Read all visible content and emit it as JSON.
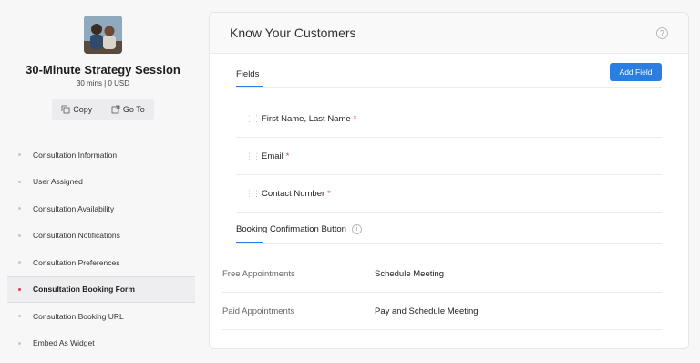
{
  "session": {
    "title": "30-Minute Strategy Session",
    "meta": "30 mins | 0 USD",
    "copy_label": "Copy",
    "goto_label": "Go To"
  },
  "nav": [
    {
      "label": "Consultation Information",
      "active": false
    },
    {
      "label": "User Assigned",
      "active": false
    },
    {
      "label": "Consultation Availability",
      "active": false
    },
    {
      "label": "Consultation Notifications",
      "active": false
    },
    {
      "label": "Consultation Preferences",
      "active": false
    },
    {
      "label": "Consultation Booking Form",
      "active": true
    },
    {
      "label": "Consultation Booking URL",
      "active": false
    },
    {
      "label": "Embed As Widget",
      "active": false
    }
  ],
  "card": {
    "title": "Know Your Customers",
    "tab_label": "Fields",
    "add_field_label": "Add Field",
    "fields": [
      {
        "label": "First Name, Last Name",
        "required": "*"
      },
      {
        "label": "Email",
        "required": "*"
      },
      {
        "label": "Contact Number",
        "required": "*"
      }
    ],
    "booking_section_label": "Booking Confirmation Button",
    "appointments": [
      {
        "key": "Free Appointments",
        "value": "Schedule Meeting"
      },
      {
        "key": "Paid Appointments",
        "value": "Pay and Schedule Meeting"
      }
    ]
  },
  "colors": {
    "accent": "#2a7de1",
    "required": "#e63946"
  }
}
